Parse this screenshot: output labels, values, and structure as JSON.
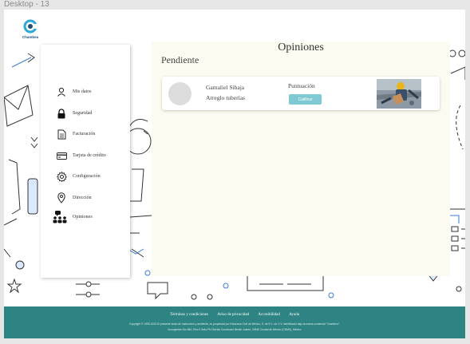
{
  "frame": {
    "label": "Desktop - 13"
  },
  "brand": {
    "name": "Chambea",
    "primary": "#1f4e79",
    "accent": "#2aa7d6"
  },
  "sidebar": {
    "items": [
      {
        "label": "Mis datos",
        "icon": "user-icon"
      },
      {
        "label": "Seguridad",
        "icon": "lock-icon"
      },
      {
        "label": "Facturación",
        "icon": "document-icon"
      },
      {
        "label": "Tarjeta de crédito",
        "icon": "credit-card-icon"
      },
      {
        "label": "Configuración",
        "icon": "gear-icon"
      },
      {
        "label": "Dirección",
        "icon": "location-pin-icon"
      },
      {
        "label": "Opiniones",
        "icon": "people-icon"
      }
    ]
  },
  "main": {
    "title": "Opiniones",
    "section": "Pendiente",
    "reviews": [
      {
        "name": "Gamaliel Sibaja",
        "service": "Arreglo tuberías",
        "rating_label": "Puntuación",
        "button_label": "Calificar",
        "photo": "plumber-work-photo"
      }
    ]
  },
  "footer": {
    "links": [
      "Términos y condiciones",
      "Aviso de privacidad",
      "Accesibilidad",
      "Ayuda"
    ],
    "copyright": "Copyright © 1999-2023 El presente aviso de Instrucción y ambiente, es propiedad por Esfuerzos Civil de México, S. de R.L. de C.V. identificado bajo la marca comercial \"Chambeo\".",
    "address": "Insurgentes Sur 860, Piso 9 Sala P6 Chirrido Constructo Benito Juarez, 03940 Ciudad de México (CDMX), México",
    "color": "#2e8383"
  }
}
